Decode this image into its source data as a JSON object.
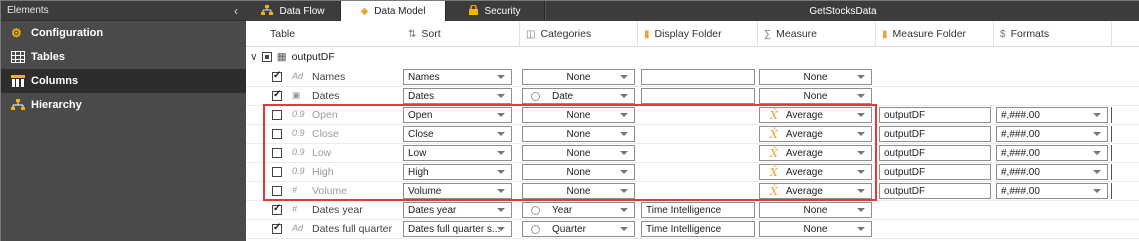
{
  "sidebar": {
    "header": "Elements",
    "collapse_icon": "chevron-left-icon",
    "items": [
      {
        "label": "Configuration",
        "icon": "gear-icon"
      },
      {
        "label": "Tables",
        "icon": "grid-icon"
      },
      {
        "label": "Columns",
        "icon": "columns-icon"
      },
      {
        "label": "Hierarchy",
        "icon": "hierarchy-icon"
      }
    ]
  },
  "tabs": [
    {
      "label": "Data Flow",
      "icon": "dataflow-icon"
    },
    {
      "label": "Data Model",
      "icon": "diamond-icon"
    },
    {
      "label": "Security",
      "icon": "lock-icon"
    }
  ],
  "window_title": "GetStocksData",
  "columns": {
    "table": "Table",
    "sort": "Sort",
    "categories": "Categories",
    "display_folder": "Display Folder",
    "measure": "Measure",
    "measure_folder": "Measure Folder",
    "formats": "Formats"
  },
  "tree": {
    "name": "outputDF"
  },
  "rows": [
    {
      "checked": true,
      "type": "Ad",
      "name": "Names",
      "sort": "Names",
      "category": "None",
      "display_folder": "",
      "measure": "None",
      "measure_folder": "",
      "format": ""
    },
    {
      "checked": true,
      "type": "date",
      "name": "Dates",
      "sort": "Dates",
      "category": "Date",
      "display_folder": "",
      "measure": "None",
      "measure_folder": "",
      "format": ""
    },
    {
      "checked": false,
      "type": "0.9",
      "name": "Open",
      "sort": "Open",
      "category": "None",
      "display_folder": "",
      "measure": "Average",
      "measure_folder": "outputDF",
      "format": "#,###.00"
    },
    {
      "checked": false,
      "type": "0.9",
      "name": "Close",
      "sort": "Close",
      "category": "None",
      "display_folder": "",
      "measure": "Average",
      "measure_folder": "outputDF",
      "format": "#,###.00"
    },
    {
      "checked": false,
      "type": "0.9",
      "name": "Low",
      "sort": "Low",
      "category": "None",
      "display_folder": "",
      "measure": "Average",
      "measure_folder": "outputDF",
      "format": "#,###.00"
    },
    {
      "checked": false,
      "type": "0.9",
      "name": "High",
      "sort": "High",
      "category": "None",
      "display_folder": "",
      "measure": "Average",
      "measure_folder": "outputDF",
      "format": "#,###.00"
    },
    {
      "checked": false,
      "type": "#",
      "name": "Volume",
      "sort": "Volume",
      "category": "None",
      "display_folder": "",
      "measure": "Average",
      "measure_folder": "outputDF",
      "format": "#,###.00"
    },
    {
      "checked": true,
      "type": "#",
      "name": "Dates year",
      "sort": "Dates year",
      "category": "Year",
      "display_folder": "Time Intelligence",
      "measure": "None",
      "measure_folder": "",
      "format": ""
    },
    {
      "checked": true,
      "type": "Ad",
      "name": "Dates full quarter",
      "sort": "Dates full quarter s...",
      "category": "Quarter",
      "display_folder": "Time Intelligence",
      "measure": "None",
      "measure_folder": "",
      "format": ""
    }
  ],
  "highlight_color": "#e03a3a"
}
